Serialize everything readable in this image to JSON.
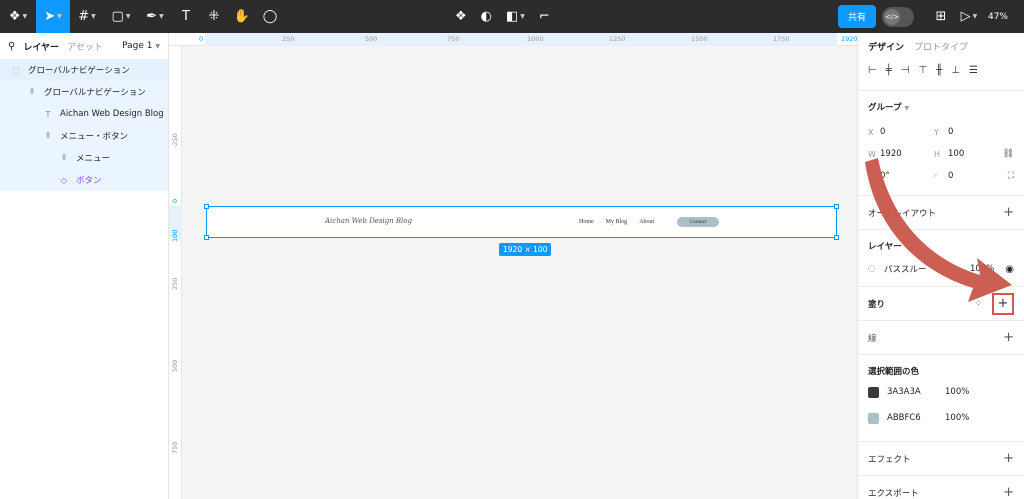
{
  "toolbar": {
    "share_label": "共有",
    "dev_mode_label": "</>",
    "zoom": "47%"
  },
  "left_panel": {
    "tab_layers": "レイヤー",
    "tab_assets": "アセット",
    "page": "Page 1",
    "layers": [
      {
        "label": "グローバルナビゲーション",
        "indent": 0,
        "kind": "frame"
      },
      {
        "label": "グローバルナビゲーション",
        "indent": 1,
        "kind": "autolayout"
      },
      {
        "label": "Aichan Web Design Blog",
        "indent": 2,
        "kind": "text"
      },
      {
        "label": "メニュー・ボタン",
        "indent": 2,
        "kind": "autolayout"
      },
      {
        "label": "メニュー",
        "indent": 3,
        "kind": "autolayout"
      },
      {
        "label": "ボタン",
        "indent": 3,
        "kind": "component"
      }
    ]
  },
  "canvas": {
    "ruler_top": [
      "0",
      "250",
      "500",
      "750",
      "1000",
      "1250",
      "1500",
      "1750",
      "1920"
    ],
    "ruler_left": [
      "-250",
      "0",
      "100",
      "250",
      "500",
      "750"
    ],
    "site_logo": "Aichan Web Design Blog",
    "nav": [
      "Home",
      "My Blog",
      "About"
    ],
    "contact": "Contact",
    "dimensions": "1920 × 100"
  },
  "right_panel": {
    "tab_design": "デザイン",
    "tab_prototype": "プロトタイプ",
    "group_title": "グループ",
    "x_label": "X",
    "x": "0",
    "y_label": "Y",
    "y": "0",
    "w_label": "W",
    "w": "1920",
    "h_label": "H",
    "h": "100",
    "rotation": "0°",
    "radius": "0",
    "auto_layout": "オートレイアウト",
    "layer_title": "レイヤー",
    "pass_through": "パススルー",
    "opacity": "100%",
    "fill": "塗り",
    "stroke": "線",
    "selection_colors": "選択範囲の色",
    "colors": [
      {
        "hex": "3A3A3A",
        "opacity": "100%",
        "color": "#3a3a3a"
      },
      {
        "hex": "ABBFC6",
        "opacity": "100%",
        "color": "#abbfc6"
      }
    ],
    "effects": "エフェクト",
    "export": "エクスポート"
  }
}
